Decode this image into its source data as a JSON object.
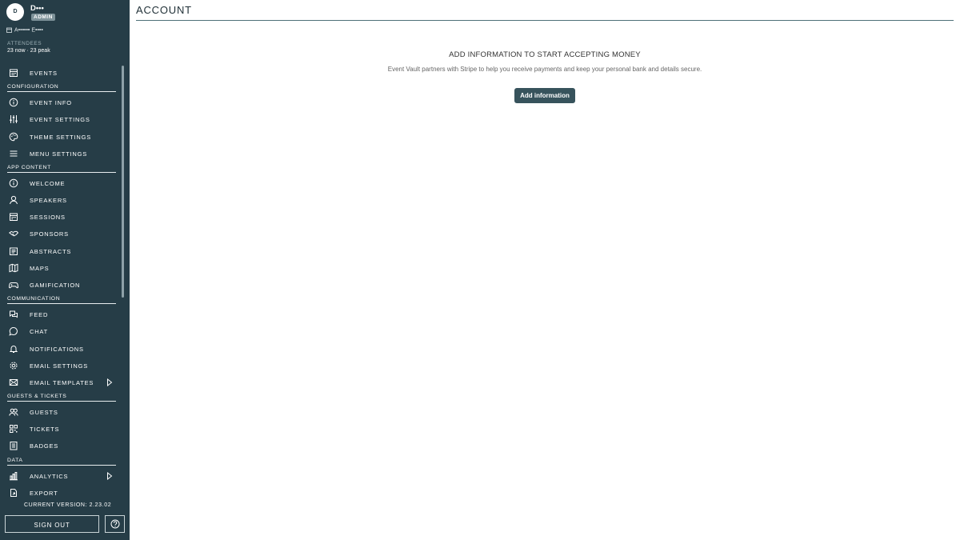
{
  "user": {
    "initial": "D",
    "name": "D•••",
    "role": "ADMIN",
    "org": "A•••••• E••••"
  },
  "attendees": {
    "label": "ATTENDEES",
    "summary": "23 now · 23 peak"
  },
  "menu": {
    "events": "EVENTS",
    "sections": {
      "configuration": "CONFIGURATION",
      "app_content": "APP CONTENT",
      "communication": "COMMUNICATION",
      "guests_tickets": "GUESTS & TICKETS",
      "data": "DATA"
    },
    "items": {
      "event_info": "EVENT INFO",
      "event_settings": "EVENT SETTINGS",
      "theme_settings": "THEME SETTINGS",
      "menu_settings": "MENU SETTINGS",
      "welcome": "WELCOME",
      "speakers": "SPEAKERS",
      "sessions": "SESSIONS",
      "sponsors": "SPONSORS",
      "abstracts": "ABSTRACTS",
      "maps": "MAPS",
      "gamification": "GAMIFICATION",
      "feed": "FEED",
      "chat": "CHAT",
      "notifications": "NOTIFICATIONS",
      "email_settings": "EMAIL SETTINGS",
      "email_templates": "EMAIL TEMPLATES",
      "guests": "GUESTS",
      "tickets": "TICKETS",
      "badges": "BADGES",
      "analytics": "ANALYTICS",
      "export": "EXPORT"
    }
  },
  "footer": {
    "version": "CURRENT VERSION: 2.23.02",
    "sign_out": "SIGN OUT"
  },
  "main": {
    "title": "ACCOUNT",
    "heading": "ADD INFORMATION TO START ACCEPTING MONEY",
    "description": "Event Vault partners with Stripe to help you receive payments and keep your personal bank and details secure.",
    "button": "Add information"
  },
  "colors": {
    "sidebar_bg": "#263d47",
    "accent": "#37535c",
    "badge": "#7d9299"
  }
}
